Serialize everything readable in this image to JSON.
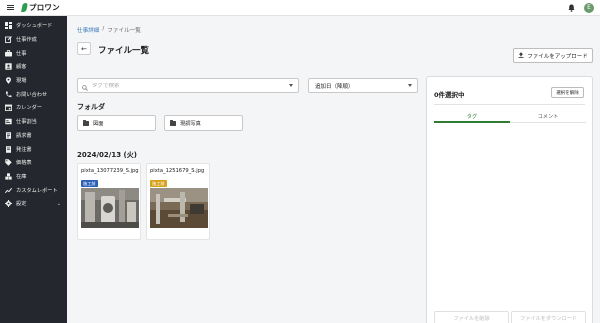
{
  "app": {
    "logo_text": "プロワン",
    "avatar_initial": "E",
    "brand_color": "#2e9d4f"
  },
  "sidebar": {
    "items": [
      {
        "label": "ダッシュボード",
        "icon": "dashboard-icon"
      },
      {
        "label": "仕事作成",
        "icon": "edit-icon"
      },
      {
        "label": "仕事",
        "icon": "briefcase-icon"
      },
      {
        "label": "顧客",
        "icon": "contact-card-icon"
      },
      {
        "label": "現場",
        "icon": "location-pin-icon"
      },
      {
        "label": "お問い合わせ",
        "icon": "phone-icon"
      },
      {
        "label": "カレンダー",
        "icon": "calendar-icon"
      },
      {
        "label": "仕事割当",
        "icon": "assign-icon"
      },
      {
        "label": "請求書",
        "icon": "invoice-icon"
      },
      {
        "label": "発注書",
        "icon": "order-icon"
      },
      {
        "label": "価格表",
        "icon": "price-tag-icon"
      },
      {
        "label": "在庫",
        "icon": "inventory-icon"
      },
      {
        "label": "カスタムレポート",
        "icon": "chart-line-icon"
      },
      {
        "label": "設定",
        "icon": "gear-icon"
      }
    ]
  },
  "breadcrumb": {
    "parent": "仕事詳細",
    "separator": "/",
    "current": "ファイル一覧"
  },
  "header": {
    "title": "ファイル一覧",
    "upload_label": "ファイルをアップロード"
  },
  "filters": {
    "search_placeholder": "タグで検索",
    "sort_value": "追加日（降順）"
  },
  "folders": {
    "heading": "フォルダ",
    "items": [
      "図面",
      "現調写真"
    ]
  },
  "date_group": {
    "heading": "2024/02/13 (火)",
    "files": [
      {
        "name": "pixta_13077239_S.jpg",
        "badge": "施工前",
        "badge_color": "#2b5fb8"
      },
      {
        "name": "pixta_1251679_S.jpg",
        "badge": "施工前",
        "badge_color": "#d6a21a"
      }
    ]
  },
  "selection_panel": {
    "title": "0件選択中",
    "deselect_label": "選択を解除",
    "tabs": [
      "タグ",
      "コメント"
    ],
    "delete_label": "ファイルを削除",
    "download_label": "ファイルをダウンロード"
  }
}
